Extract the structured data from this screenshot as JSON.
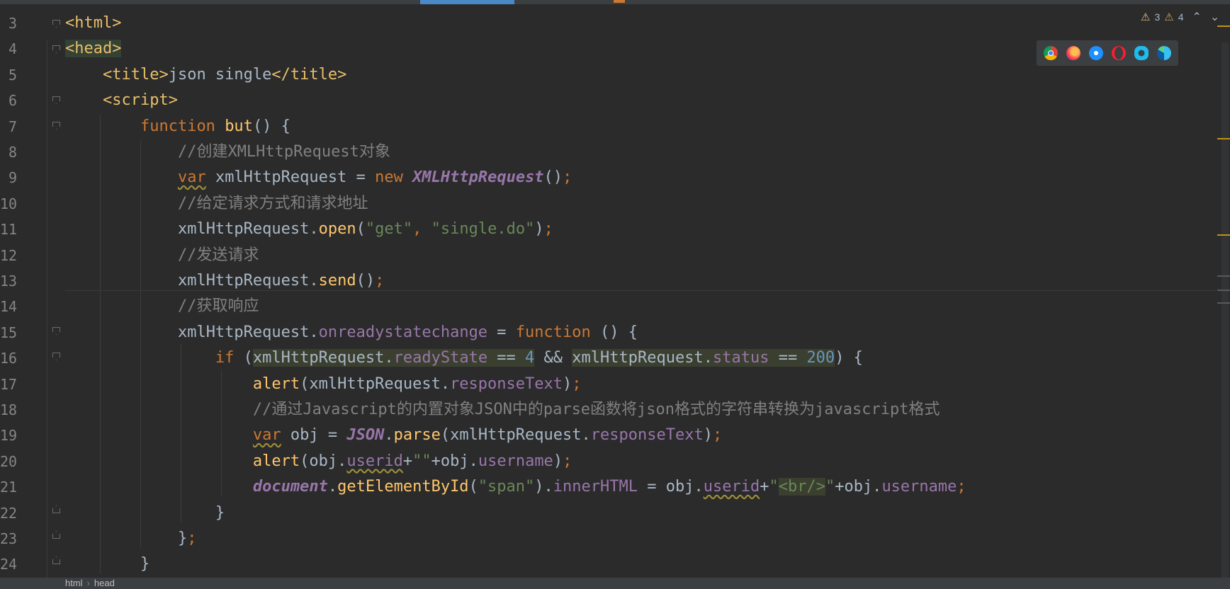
{
  "editor": {
    "line_numbers": [
      "3",
      "4",
      "5",
      "6",
      "7",
      "8",
      "9",
      "10",
      "11",
      "12",
      "13",
      "14",
      "15",
      "16",
      "17",
      "18",
      "19",
      "20",
      "21",
      "22",
      "23",
      "24"
    ],
    "lines": {
      "l3": [
        "<html>"
      ],
      "l4": [
        "<head>"
      ],
      "l5": [
        "    ",
        "<title>",
        "json single",
        "</title>"
      ],
      "l6": [
        "    ",
        "<script>"
      ],
      "l7": [
        "        ",
        "function",
        " ",
        "but",
        "() {"
      ],
      "l8": [
        "            ",
        "//创建XMLHttpRequest对象"
      ],
      "l9": [
        "            ",
        "var",
        " xmlHttpRequest = ",
        "new",
        " ",
        "XMLHttpRequest",
        "()",
        ";"
      ],
      "l10": [
        "            ",
        "//给定请求方式和请求地址"
      ],
      "l11": [
        "            ",
        "xmlHttpRequest.",
        "open",
        "(",
        "\"get\"",
        ", ",
        "\"single.do\"",
        ")",
        ";"
      ],
      "l12": [
        "            ",
        "//发送请求"
      ],
      "l13": [
        "            ",
        "xmlHttpRequest.",
        "send",
        "()",
        ";"
      ],
      "l14": [
        "            ",
        "//获取响应"
      ],
      "l15": [
        "            ",
        "xmlHttpRequest.",
        "onreadystatechange",
        " = ",
        "function",
        " () {"
      ],
      "l16": [
        "                ",
        "if",
        " (",
        "xmlHttpRequest.",
        "readyState",
        " == ",
        "4",
        " && ",
        "xmlHttpRequest.",
        "status",
        " == ",
        "200",
        ") {"
      ],
      "l17": [
        "                    ",
        "alert",
        "(xmlHttpRequest.",
        "responseText",
        ")",
        ";"
      ],
      "l18": [
        "                    ",
        "//通过Javascript的内置对象JSON中的parse函数将json格式的字符串转换为javascript格式"
      ],
      "l19": [
        "                    ",
        "var",
        " obj = ",
        "JSON",
        ".",
        "parse",
        "(xmlHttpRequest.",
        "responseText",
        ")",
        ";"
      ],
      "l20": [
        "                    ",
        "alert",
        "(obj.",
        "userid",
        "+",
        "\"\"",
        "+obj.",
        "username",
        ")",
        ";"
      ],
      "l21": [
        "                    ",
        "document",
        ".",
        "getElementById",
        "(",
        "\"span\"",
        ").",
        "innerHTML",
        " = obj.",
        "userid",
        "+",
        "\"",
        "<br/>",
        "\"",
        "+obj.",
        "username",
        ";"
      ],
      "l22": [
        "                ",
        "}"
      ],
      "l23": [
        "            ",
        "}",
        ";"
      ],
      "l24": [
        "        ",
        "}"
      ]
    }
  },
  "inspections": {
    "warnings": "3",
    "weak_warnings": "4"
  },
  "browser_icons": [
    "chrome-icon",
    "firefox-icon",
    "safari-icon",
    "opera-icon",
    "ie-icon",
    "edge-icon"
  ],
  "colors": {
    "background": "#2b2b2b",
    "keyword": "#cc7832",
    "tag": "#e8bf6a",
    "string": "#6a8759",
    "comment": "#808080",
    "property": "#9876aa",
    "number": "#6897bb",
    "function": "#ffc66d"
  },
  "breadcrumb": {
    "items": [
      "html",
      "head"
    ]
  }
}
